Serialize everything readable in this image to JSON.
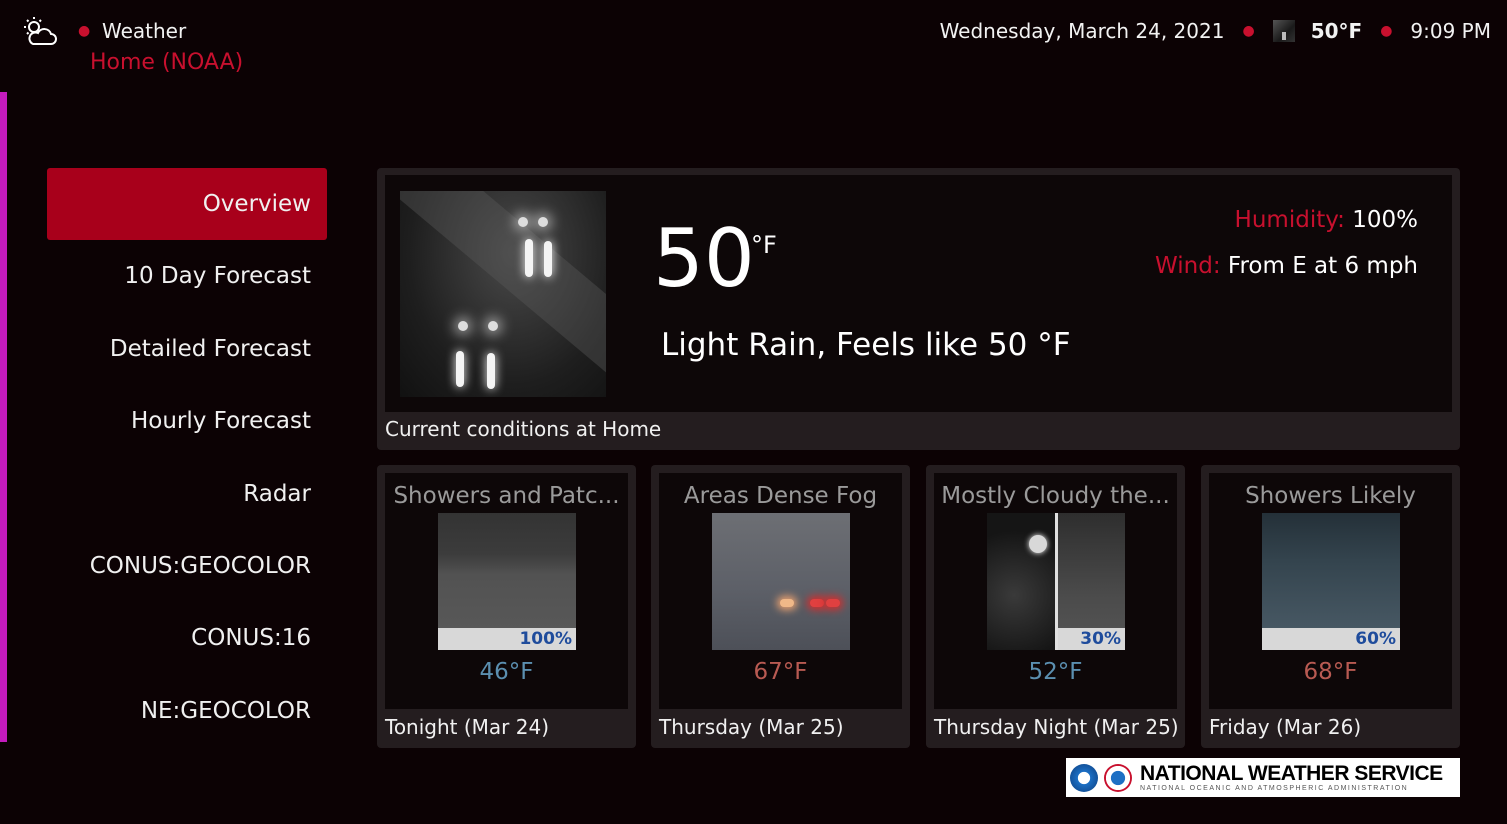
{
  "header": {
    "app_title": "Weather",
    "location": "Home (NOAA)",
    "date": "Wednesday, March 24, 2021",
    "temp": "50°F",
    "time": "9:09 PM"
  },
  "menu": {
    "items": [
      {
        "label": "Overview",
        "active": true
      },
      {
        "label": "10 Day Forecast"
      },
      {
        "label": "Detailed Forecast"
      },
      {
        "label": "Hourly Forecast"
      },
      {
        "label": "Radar"
      },
      {
        "label": "CONUS:GEOCOLOR"
      },
      {
        "label": "CONUS:16"
      },
      {
        "label": "NE:GEOCOLOR"
      }
    ]
  },
  "current": {
    "temperature": "50",
    "unit": "°F",
    "condition": "Light Rain, Feels like 50 °F",
    "humidity_label": "Humidity:",
    "humidity_value": "100%",
    "wind_label": "Wind:",
    "wind_value": "From E at 6 mph",
    "caption": "Current conditions at Home"
  },
  "forecast": [
    {
      "title": "Showers and Patc...",
      "percent": "100%",
      "temp": "46°F",
      "temp_color": "#5b8fb0",
      "caption": "Tonight (Mar 24)"
    },
    {
      "title": "Areas Dense Fog",
      "percent": "",
      "temp": "67°F",
      "temp_color": "#b85a52",
      "caption": "Thursday (Mar 25)"
    },
    {
      "title": "Mostly Cloudy the...",
      "percent": "30%",
      "temp": "52°F",
      "temp_color": "#5b8fb0",
      "caption": "Thursday Night (Mar 25)"
    },
    {
      "title": "Showers Likely",
      "percent": "60%",
      "temp": "68°F",
      "temp_color": "#b85a52",
      "caption": "Friday (Mar 26)"
    }
  ],
  "footer": {
    "logo_title": "NATIONAL WEATHER SERVICE",
    "logo_subtitle": "NATIONAL OCEANIC AND ATMOSPHERIC ADMINISTRATION"
  },
  "colors": {
    "accent": "#c8102e",
    "active_menu": "#a8001b",
    "edge_bar": "#c41bbd"
  }
}
